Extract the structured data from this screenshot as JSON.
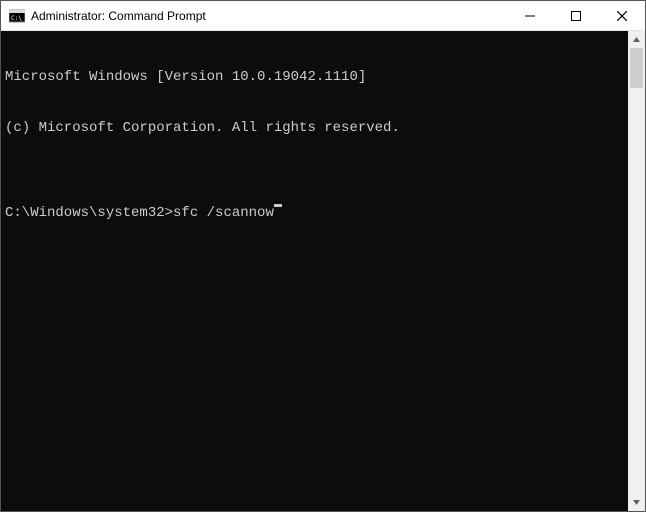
{
  "window": {
    "title": "Administrator: Command Prompt",
    "icon_name": "cmd-icon"
  },
  "terminal": {
    "lines": [
      "Microsoft Windows [Version 10.0.19042.1110]",
      "(c) Microsoft Corporation. All rights reserved.",
      ""
    ],
    "prompt": "C:\\Windows\\system32>",
    "command": "sfc /scannow"
  }
}
